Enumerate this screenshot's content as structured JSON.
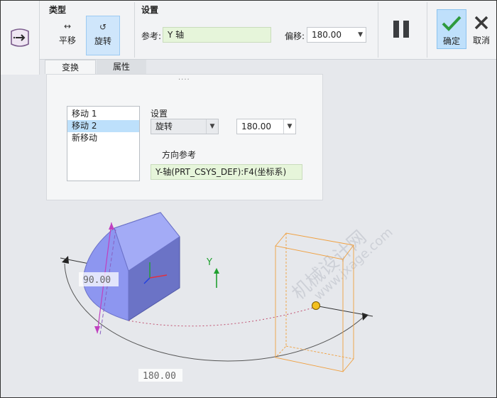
{
  "ribbon": {
    "type_group_title": "类型",
    "type_buttons": [
      {
        "icon": "↔",
        "label": "平移"
      },
      {
        "icon": "↺",
        "label": "旋转"
      }
    ],
    "settings_group_title": "设置",
    "ref_label": "参考:",
    "ref_value": "Y 轴",
    "offset_label": "偏移:",
    "offset_value": "180.00",
    "ok_label": "确定",
    "cancel_label": "取消"
  },
  "tabs": [
    "变换",
    "属性"
  ],
  "panel": {
    "moves": [
      "移动 1",
      "移动 2",
      "新移动"
    ],
    "selected_move": "移动 2",
    "settings_label": "设置",
    "motion_type": "旋转",
    "angle_value": "180.00",
    "direction_label": "方向参考",
    "direction_value": "Y-轴(PRT_CSYS_DEF):F4(坐标系)"
  },
  "viewport": {
    "dim_angle_small": "90.00",
    "dim_angle_large": "180.00",
    "axis_label": "Y",
    "watermark_line1": "机械设计网",
    "watermark_line2": "www.jxage.com"
  },
  "colors": {
    "accent": "#bfe0fb",
    "ref_field": "#e6f5da",
    "part_fill": "#8f98f0",
    "bbox": "#f0a040",
    "axis_magenta": "#c040c0",
    "axis_green": "#20a030"
  }
}
